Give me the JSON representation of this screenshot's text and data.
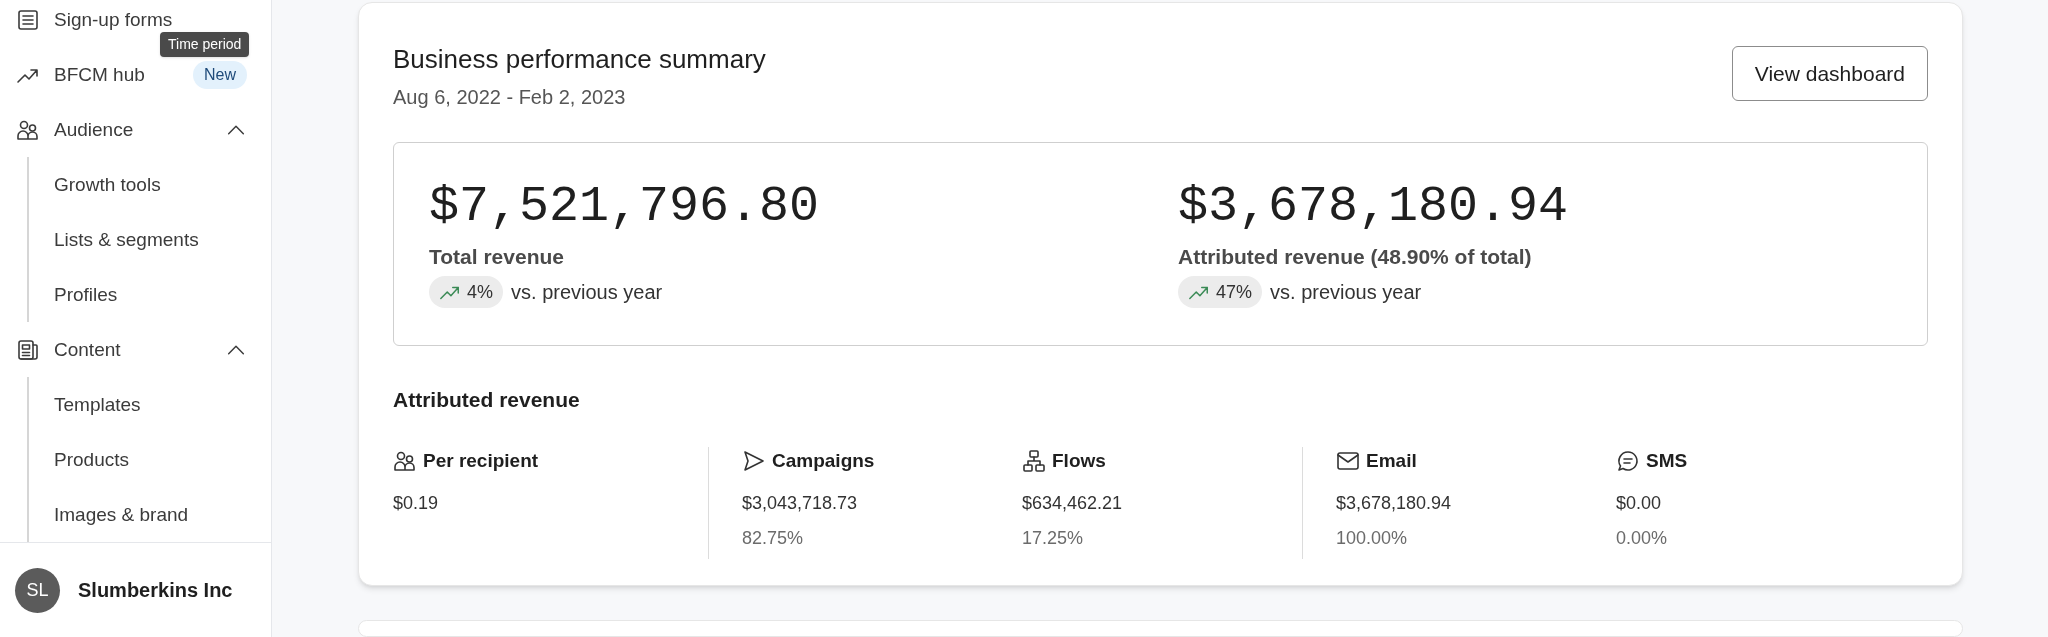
{
  "sidebar": {
    "items": [
      {
        "label": "Sign-up forms"
      },
      {
        "label": "BFCM hub",
        "badge": "New"
      },
      {
        "label": "Audience",
        "expanded": true,
        "children": [
          {
            "label": "Growth tools"
          },
          {
            "label": "Lists & segments"
          },
          {
            "label": "Profiles"
          }
        ]
      },
      {
        "label": "Content",
        "expanded": true,
        "children": [
          {
            "label": "Templates"
          },
          {
            "label": "Products"
          },
          {
            "label": "Images & brand"
          }
        ]
      }
    ],
    "tooltip": "Time period",
    "account": {
      "initials": "SL",
      "name": "Slumberkins Inc"
    }
  },
  "summary": {
    "title": "Business performance summary",
    "date_range": "Aug 6, 2022 - Feb 2, 2023",
    "button": "View dashboard",
    "metrics": [
      {
        "value": "$7,521,796.80",
        "label": "Total revenue",
        "change": "4%",
        "comparison": "vs. previous year"
      },
      {
        "value": "$3,678,180.94",
        "label": "Attributed revenue (48.90% of total)",
        "change": "47%",
        "comparison": "vs. previous year"
      }
    ],
    "attributed": {
      "title": "Attributed revenue",
      "groups": [
        [
          {
            "label": "Per recipient",
            "value": "$0.19"
          }
        ],
        [
          {
            "label": "Campaigns",
            "value": "$3,043,718.73",
            "share": "82.75%"
          },
          {
            "label": "Flows",
            "value": "$634,462.21",
            "share": "17.25%"
          }
        ],
        [
          {
            "label": "Email",
            "value": "$3,678,180.94",
            "share": "100.00%"
          },
          {
            "label": "SMS",
            "value": "$0.00",
            "share": "0.00%"
          }
        ]
      ]
    }
  }
}
